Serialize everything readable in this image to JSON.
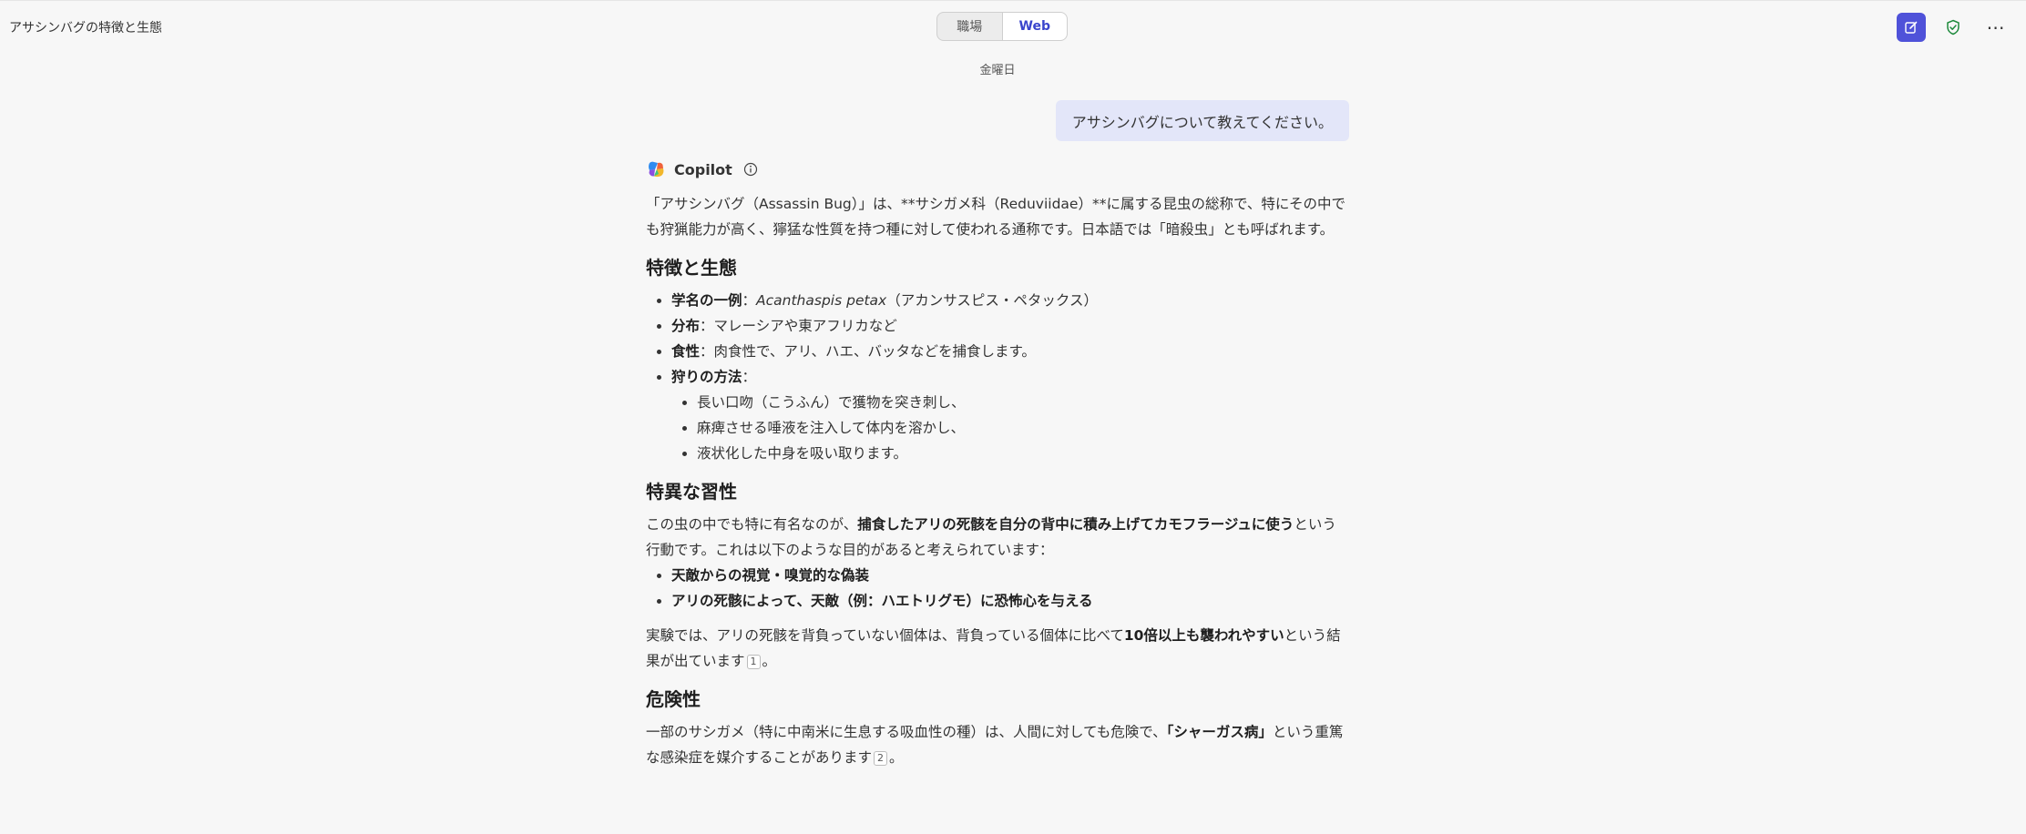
{
  "header": {
    "title": "アサシンバグの特徴と生態",
    "modes": [
      "職場",
      "Web"
    ],
    "active_mode": "Web"
  },
  "chat": {
    "day": "金曜日",
    "user_message": "アサシンバグについて教えてください。",
    "assistant_name": "Copilot",
    "intro": "「アサシンバグ（Assassin Bug）」は、**サシガメ科（Reduviidae）**に属する昆虫の総称で、特にその中でも狩猟能力が高く、獰猛な性質を持つ種に対して使われる通称です。日本語では「暗殺虫」とも呼ばれます。",
    "section1": {
      "heading": "特徴と生態",
      "items": [
        {
          "label": "学名の一例",
          "sep": "：",
          "italic": "Acanthaspis petax",
          "text": "（アカンサスピス・ペタックス）"
        },
        {
          "label": "分布",
          "sep": "：",
          "text": "マレーシアや東アフリカなど"
        },
        {
          "label": "食性",
          "sep": "：",
          "text": "肉食性で、アリ、ハエ、バッタなどを捕食します。"
        },
        {
          "label": "狩りの方法",
          "sep": "："
        }
      ],
      "hunting_steps": [
        "長い口吻（こうふん）で獲物を突き刺し、",
        "麻痺させる唾液を注入して体内を溶かし、",
        "液状化した中身を吸い取ります。"
      ]
    },
    "section2": {
      "heading": "特異な習性",
      "p1_before": "この虫の中でも特に有名なのが、",
      "p1_bold": "捕食したアリの死骸を自分の背中に積み上げてカモフラージュに使う",
      "p1_after": "という行動です。これは以下のような目的があると考えられています：",
      "bullets": [
        "天敵からの視覚・嗅覚的な偽装",
        "アリの死骸によって、天敵（例：ハエトリグモ）に恐怖心を与える"
      ],
      "p2_before": "実験では、アリの死骸を背負っていない個体は、背負っている個体に比べて",
      "p2_bold": "10倍以上も襲われやすい",
      "p2_after": "という結果が出ています",
      "p2_cite": "1",
      "p2_end": "。"
    },
    "section3": {
      "heading": "危険性",
      "p_before": "一部のサシガメ（特に中南米に生息する吸血性の種）は、人間に対しても危険で、",
      "p_bold": "「シャーガス病」",
      "p_after": "という重篤な感染症を媒介することがあります",
      "p_cite": "2",
      "p_end": "。"
    }
  },
  "colors": {
    "accent": "#4f52d9",
    "user_bubble": "#e3e6f9",
    "shield": "#1e8a3c",
    "background": "#f7f7f7"
  },
  "icons": [
    "new-chat-icon",
    "shield-check-icon",
    "more-icon",
    "copilot-logo-icon",
    "info-icon"
  ]
}
